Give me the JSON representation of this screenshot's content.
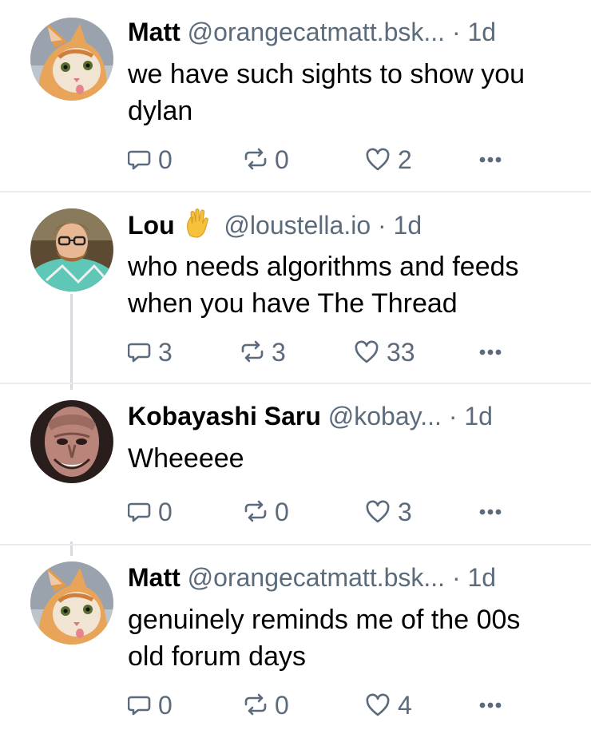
{
  "colors": {
    "meta": "#5b6b7c",
    "divider": "#e9ecef",
    "thread_line": "#d7dbe0"
  },
  "posts": [
    {
      "name": "Matt",
      "handle": "@orangecatmatt.bsk...",
      "time": "· 1d",
      "text_lines": [
        "we have such sights to show you",
        "dylan"
      ],
      "replies": "0",
      "reposts": "0",
      "likes": "2",
      "avatar_icon": "orange-cat-avatar"
    },
    {
      "name": "Lou",
      "emoji": "vulcan-salute-icon",
      "handle": "@loustella.io",
      "time": "· 1d",
      "text_lines": [
        "who needs algorithms and feeds",
        "when you have The Thread"
      ],
      "replies": "3",
      "reposts": "3",
      "likes": "33",
      "avatar_icon": "person-glasses-avatar"
    },
    {
      "name": "Kobayashi Saru",
      "handle": "@kobay...",
      "time": "· 1d",
      "text_lines": [
        "Wheeeee"
      ],
      "replies": "0",
      "reposts": "0",
      "likes": "3",
      "avatar_icon": "alien-face-avatar"
    },
    {
      "name": "Matt",
      "handle": "@orangecatmatt.bsk...",
      "time": "· 1d",
      "text_lines": [
        "genuinely reminds me of the 00s",
        "old forum days"
      ],
      "replies": "0",
      "reposts": "0",
      "likes": "4",
      "avatar_icon": "orange-cat-avatar"
    }
  ]
}
